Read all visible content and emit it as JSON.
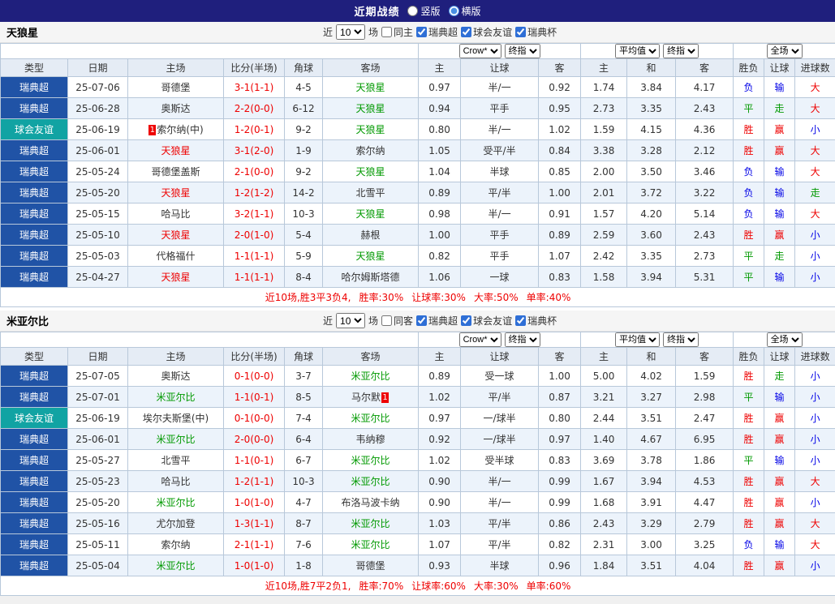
{
  "titlebar": {
    "title": "近期战绩",
    "radio_vertical": "竖版",
    "radio_horizontal": "横版",
    "selected": "横版"
  },
  "colors": {
    "titlebar_bg": "#1f1f7d",
    "league_blue": "#2053a6",
    "friendly_teal": "#11a3a3",
    "win_red": "#ee0000",
    "draw_green": "#009900",
    "lose_blue": "#0000e6",
    "header_bg": "#e5ecf5",
    "alt_row_bg": "#ecf3fb",
    "border": "#b8c8da"
  },
  "table_header": {
    "selects": {
      "bookmaker": "Crow*",
      "bookmaker_stage": "终指",
      "europe_avg": "平均值",
      "europe_stage": "终指",
      "scope": "全场"
    },
    "columns": [
      "类型",
      "日期",
      "主场",
      "比分(半场)",
      "角球",
      "客场",
      "主",
      "让球",
      "客",
      "主",
      "和",
      "客",
      "胜负",
      "让球",
      "进球数"
    ]
  },
  "sections": [
    {
      "team": "天狼星",
      "filters": {
        "near_label": "近",
        "count": "10",
        "matches_label": "场",
        "same_venue": {
          "label": "同主",
          "checked": false
        },
        "competitions": [
          {
            "label": "瑞典超",
            "checked": true
          },
          {
            "label": "球会友谊",
            "checked": true
          },
          {
            "label": "瑞典杯",
            "checked": true
          }
        ]
      },
      "rows": [
        {
          "type": "瑞典超",
          "type_style": "blue",
          "date": "25-07-06",
          "home": {
            "name": "哥德堡"
          },
          "score": "3-1(1-1)",
          "corner": "4-5",
          "away": {
            "name": "天狼星",
            "color": "green"
          },
          "asia": [
            "0.97",
            "半/一",
            "0.92"
          ],
          "europe": [
            "1.74",
            "3.84",
            "4.17"
          ],
          "outcome": [
            [
              "负",
              "blue"
            ],
            [
              "输",
              "blue"
            ],
            [
              "大",
              "red"
            ]
          ]
        },
        {
          "type": "瑞典超",
          "type_style": "blue",
          "date": "25-06-28",
          "home": {
            "name": "奥斯达"
          },
          "score": "2-2(0-0)",
          "corner": "6-12",
          "away": {
            "name": "天狼星",
            "color": "green"
          },
          "asia": [
            "0.94",
            "平手",
            "0.95"
          ],
          "europe": [
            "2.73",
            "3.35",
            "2.43"
          ],
          "outcome": [
            [
              "平",
              "green"
            ],
            [
              "走",
              "green"
            ],
            [
              "大",
              "red"
            ]
          ]
        },
        {
          "type": "球会友谊",
          "type_style": "teal",
          "date": "25-06-19",
          "home": {
            "name": "索尔纳(中)",
            "badge": "1",
            "badge_pos": "before"
          },
          "score": "1-2(0-1)",
          "corner": "9-2",
          "away": {
            "name": "天狼星",
            "color": "green"
          },
          "asia": [
            "0.80",
            "半/一",
            "1.02"
          ],
          "europe": [
            "1.59",
            "4.15",
            "4.36"
          ],
          "outcome": [
            [
              "胜",
              "red"
            ],
            [
              "赢",
              "red"
            ],
            [
              "小",
              "blue"
            ]
          ]
        },
        {
          "type": "瑞典超",
          "type_style": "blue",
          "date": "25-06-01",
          "home": {
            "name": "天狼星",
            "color": "red"
          },
          "score": "3-1(2-0)",
          "corner": "1-9",
          "away": {
            "name": "索尔纳"
          },
          "asia": [
            "1.05",
            "受平/半",
            "0.84"
          ],
          "europe": [
            "3.38",
            "3.28",
            "2.12"
          ],
          "outcome": [
            [
              "胜",
              "red"
            ],
            [
              "赢",
              "red"
            ],
            [
              "大",
              "red"
            ]
          ]
        },
        {
          "type": "瑞典超",
          "type_style": "blue",
          "date": "25-05-24",
          "home": {
            "name": "哥德堡盖斯"
          },
          "score": "2-1(0-0)",
          "corner": "9-2",
          "away": {
            "name": "天狼星",
            "color": "green"
          },
          "asia": [
            "1.04",
            "半球",
            "0.85"
          ],
          "europe": [
            "2.00",
            "3.50",
            "3.46"
          ],
          "outcome": [
            [
              "负",
              "blue"
            ],
            [
              "输",
              "blue"
            ],
            [
              "大",
              "red"
            ]
          ]
        },
        {
          "type": "瑞典超",
          "type_style": "blue",
          "date": "25-05-20",
          "home": {
            "name": "天狼星",
            "color": "red"
          },
          "score": "1-2(1-2)",
          "corner": "14-2",
          "away": {
            "name": "北雪平"
          },
          "asia": [
            "0.89",
            "平/半",
            "1.00"
          ],
          "europe": [
            "2.01",
            "3.72",
            "3.22"
          ],
          "outcome": [
            [
              "负",
              "blue"
            ],
            [
              "输",
              "blue"
            ],
            [
              "走",
              "green"
            ]
          ]
        },
        {
          "type": "瑞典超",
          "type_style": "blue",
          "date": "25-05-15",
          "home": {
            "name": "哈马比"
          },
          "score": "3-2(1-1)",
          "corner": "10-3",
          "away": {
            "name": "天狼星",
            "color": "green"
          },
          "asia": [
            "0.98",
            "半/一",
            "0.91"
          ],
          "europe": [
            "1.57",
            "4.20",
            "5.14"
          ],
          "outcome": [
            [
              "负",
              "blue"
            ],
            [
              "输",
              "blue"
            ],
            [
              "大",
              "red"
            ]
          ]
        },
        {
          "type": "瑞典超",
          "type_style": "blue",
          "date": "25-05-10",
          "home": {
            "name": "天狼星",
            "color": "red"
          },
          "score": "2-0(1-0)",
          "corner": "5-4",
          "away": {
            "name": "赫根"
          },
          "asia": [
            "1.00",
            "平手",
            "0.89"
          ],
          "europe": [
            "2.59",
            "3.60",
            "2.43"
          ],
          "outcome": [
            [
              "胜",
              "red"
            ],
            [
              "赢",
              "red"
            ],
            [
              "小",
              "blue"
            ]
          ]
        },
        {
          "type": "瑞典超",
          "type_style": "blue",
          "date": "25-05-03",
          "home": {
            "name": "代格福什"
          },
          "score": "1-1(1-1)",
          "corner": "5-9",
          "away": {
            "name": "天狼星",
            "color": "green"
          },
          "asia": [
            "0.82",
            "平手",
            "1.07"
          ],
          "europe": [
            "2.42",
            "3.35",
            "2.73"
          ],
          "outcome": [
            [
              "平",
              "green"
            ],
            [
              "走",
              "green"
            ],
            [
              "小",
              "blue"
            ]
          ]
        },
        {
          "type": "瑞典超",
          "type_style": "blue",
          "date": "25-04-27",
          "home": {
            "name": "天狼星",
            "color": "red"
          },
          "score": "1-1(1-1)",
          "corner": "8-4",
          "away": {
            "name": "哈尔姆斯塔德"
          },
          "asia": [
            "1.06",
            "一球",
            "0.83"
          ],
          "europe": [
            "1.58",
            "3.94",
            "5.31"
          ],
          "outcome": [
            [
              "平",
              "green"
            ],
            [
              "输",
              "blue"
            ],
            [
              "小",
              "blue"
            ]
          ]
        }
      ],
      "summary_parts": [
        "近10场,胜3平3负4,",
        "胜率:30%",
        "让球率:30%",
        "大率:50%",
        "单率:40%"
      ]
    },
    {
      "team": "米亚尔比",
      "filters": {
        "near_label": "近",
        "count": "10",
        "matches_label": "场",
        "same_venue": {
          "label": "同客",
          "checked": false
        },
        "competitions": [
          {
            "label": "瑞典超",
            "checked": true
          },
          {
            "label": "球会友谊",
            "checked": true
          },
          {
            "label": "瑞典杯",
            "checked": true
          }
        ]
      },
      "rows": [
        {
          "type": "瑞典超",
          "type_style": "blue",
          "date": "25-07-05",
          "home": {
            "name": "奥斯达"
          },
          "score": "0-1(0-0)",
          "corner": "3-7",
          "away": {
            "name": "米亚尔比",
            "color": "green"
          },
          "asia": [
            "0.89",
            "受一球",
            "1.00"
          ],
          "europe": [
            "5.00",
            "4.02",
            "1.59"
          ],
          "outcome": [
            [
              "胜",
              "red"
            ],
            [
              "走",
              "green"
            ],
            [
              "小",
              "blue"
            ]
          ]
        },
        {
          "type": "瑞典超",
          "type_style": "blue",
          "date": "25-07-01",
          "home": {
            "name": "米亚尔比",
            "color": "green"
          },
          "score": "1-1(0-1)",
          "corner": "8-5",
          "away": {
            "name": "马尔默",
            "badge": "1",
            "badge_pos": "after"
          },
          "asia": [
            "1.02",
            "平/半",
            "0.87"
          ],
          "europe": [
            "3.21",
            "3.27",
            "2.98"
          ],
          "outcome": [
            [
              "平",
              "green"
            ],
            [
              "输",
              "blue"
            ],
            [
              "小",
              "blue"
            ]
          ]
        },
        {
          "type": "球会友谊",
          "type_style": "teal",
          "date": "25-06-19",
          "home": {
            "name": "埃尔夫斯堡(中)"
          },
          "score": "0-1(0-0)",
          "corner": "7-4",
          "away": {
            "name": "米亚尔比",
            "color": "green"
          },
          "asia": [
            "0.97",
            "一/球半",
            "0.80"
          ],
          "europe": [
            "2.44",
            "3.51",
            "2.47"
          ],
          "outcome": [
            [
              "胜",
              "red"
            ],
            [
              "赢",
              "red"
            ],
            [
              "小",
              "blue"
            ]
          ]
        },
        {
          "type": "瑞典超",
          "type_style": "blue",
          "date": "25-06-01",
          "home": {
            "name": "米亚尔比",
            "color": "green"
          },
          "score": "2-0(0-0)",
          "corner": "6-4",
          "away": {
            "name": "韦纳穆"
          },
          "asia": [
            "0.92",
            "一/球半",
            "0.97"
          ],
          "europe": [
            "1.40",
            "4.67",
            "6.95"
          ],
          "outcome": [
            [
              "胜",
              "red"
            ],
            [
              "赢",
              "red"
            ],
            [
              "小",
              "blue"
            ]
          ]
        },
        {
          "type": "瑞典超",
          "type_style": "blue",
          "date": "25-05-27",
          "home": {
            "name": "北雪平"
          },
          "score": "1-1(0-1)",
          "corner": "6-7",
          "away": {
            "name": "米亚尔比",
            "color": "green"
          },
          "asia": [
            "1.02",
            "受半球",
            "0.83"
          ],
          "europe": [
            "3.69",
            "3.78",
            "1.86"
          ],
          "outcome": [
            [
              "平",
              "green"
            ],
            [
              "输",
              "blue"
            ],
            [
              "小",
              "blue"
            ]
          ]
        },
        {
          "type": "瑞典超",
          "type_style": "blue",
          "date": "25-05-23",
          "home": {
            "name": "哈马比"
          },
          "score": "1-2(1-1)",
          "corner": "10-3",
          "away": {
            "name": "米亚尔比",
            "color": "green"
          },
          "asia": [
            "0.90",
            "半/一",
            "0.99"
          ],
          "europe": [
            "1.67",
            "3.94",
            "4.53"
          ],
          "outcome": [
            [
              "胜",
              "red"
            ],
            [
              "赢",
              "red"
            ],
            [
              "大",
              "red"
            ]
          ]
        },
        {
          "type": "瑞典超",
          "type_style": "blue",
          "date": "25-05-20",
          "home": {
            "name": "米亚尔比",
            "color": "green"
          },
          "score": "1-0(1-0)",
          "corner": "4-7",
          "away": {
            "name": "布洛马波卡纳"
          },
          "asia": [
            "0.90",
            "半/一",
            "0.99"
          ],
          "europe": [
            "1.68",
            "3.91",
            "4.47"
          ],
          "outcome": [
            [
              "胜",
              "red"
            ],
            [
              "赢",
              "red"
            ],
            [
              "小",
              "blue"
            ]
          ]
        },
        {
          "type": "瑞典超",
          "type_style": "blue",
          "date": "25-05-16",
          "home": {
            "name": "尤尔加登"
          },
          "score": "1-3(1-1)",
          "corner": "8-7",
          "away": {
            "name": "米亚尔比",
            "color": "green"
          },
          "asia": [
            "1.03",
            "平/半",
            "0.86"
          ],
          "europe": [
            "2.43",
            "3.29",
            "2.79"
          ],
          "outcome": [
            [
              "胜",
              "red"
            ],
            [
              "赢",
              "red"
            ],
            [
              "大",
              "red"
            ]
          ]
        },
        {
          "type": "瑞典超",
          "type_style": "blue",
          "date": "25-05-11",
          "home": {
            "name": "索尔纳"
          },
          "score": "2-1(1-1)",
          "corner": "7-6",
          "away": {
            "name": "米亚尔比",
            "color": "green"
          },
          "asia": [
            "1.07",
            "平/半",
            "0.82"
          ],
          "europe": [
            "2.31",
            "3.00",
            "3.25"
          ],
          "outcome": [
            [
              "负",
              "blue"
            ],
            [
              "输",
              "blue"
            ],
            [
              "大",
              "red"
            ]
          ]
        },
        {
          "type": "瑞典超",
          "type_style": "blue",
          "date": "25-05-04",
          "home": {
            "name": "米亚尔比",
            "color": "green"
          },
          "score": "1-0(1-0)",
          "corner": "1-8",
          "away": {
            "name": "哥德堡"
          },
          "asia": [
            "0.93",
            "半球",
            "0.96"
          ],
          "europe": [
            "1.84",
            "3.51",
            "4.04"
          ],
          "outcome": [
            [
              "胜",
              "red"
            ],
            [
              "赢",
              "red"
            ],
            [
              "小",
              "blue"
            ]
          ]
        }
      ],
      "summary_parts": [
        "近10场,胜7平2负1,",
        "胜率:70%",
        "让球率:60%",
        "大率:30%",
        "单率:60%"
      ]
    }
  ]
}
